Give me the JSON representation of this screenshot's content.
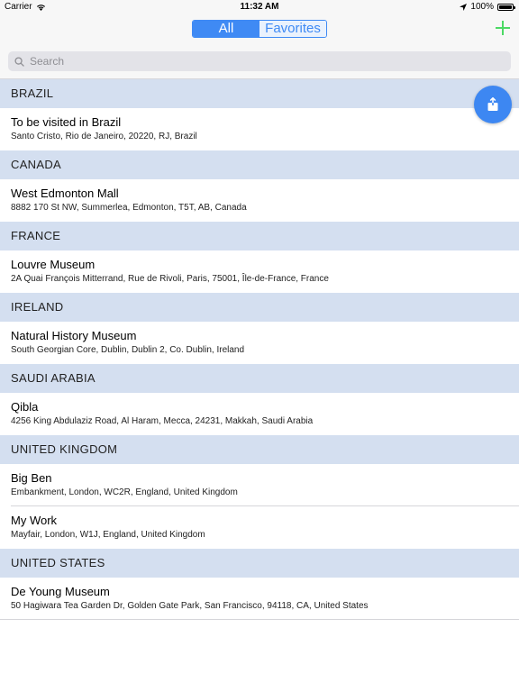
{
  "status_bar": {
    "carrier": "Carrier",
    "time": "11:32 AM",
    "battery": "100%"
  },
  "segmented": {
    "all": "All",
    "favorites": "Favorites",
    "selected": "All"
  },
  "search": {
    "placeholder": "Search"
  },
  "sections": [
    {
      "header": "BRAZIL",
      "rows": [
        {
          "title": "To be visited in Brazil",
          "subtitle": "Santo Cristo, Rio de Janeiro, 20220, RJ, Brazil"
        }
      ]
    },
    {
      "header": "CANADA",
      "rows": [
        {
          "title": "West Edmonton Mall",
          "subtitle": "8882 170 St NW, Summerlea, Edmonton, T5T, AB, Canada"
        }
      ]
    },
    {
      "header": "FRANCE",
      "rows": [
        {
          "title": "Louvre Museum",
          "subtitle": "2A Quai François Mitterrand, Rue de Rivoli, Paris, 75001, Île-de-France, France"
        }
      ]
    },
    {
      "header": "IRELAND",
      "rows": [
        {
          "title": "Natural History Museum",
          "subtitle": "South Georgian Core, Dublin, Dublin 2, Co. Dublin, Ireland"
        }
      ]
    },
    {
      "header": "SAUDI ARABIA",
      "rows": [
        {
          "title": "Qibla",
          "subtitle": "4256 King Abdulaziz Road, Al Haram, Mecca, 24231, Makkah, Saudi Arabia"
        }
      ]
    },
    {
      "header": "UNITED KINGDOM",
      "rows": [
        {
          "title": "Big Ben",
          "subtitle": "Embankment, London, WC2R, England, United Kingdom"
        },
        {
          "title": "My Work",
          "subtitle": "Mayfair, London, W1J, England, United Kingdom"
        }
      ]
    },
    {
      "header": "UNITED STATES",
      "rows": [
        {
          "title": "De Young Museum",
          "subtitle": "50 Hagiwara Tea Garden Dr, Golden Gate Park, San Francisco, 94118, CA, United States"
        }
      ]
    }
  ],
  "colors": {
    "accent": "#3f8af4",
    "add": "#4cd964",
    "section_bg": "#d4dff0",
    "fab": "#3d87f2"
  },
  "icons": {
    "add": "plus-icon",
    "fab": "share-icon",
    "search": "magnifier-icon"
  }
}
